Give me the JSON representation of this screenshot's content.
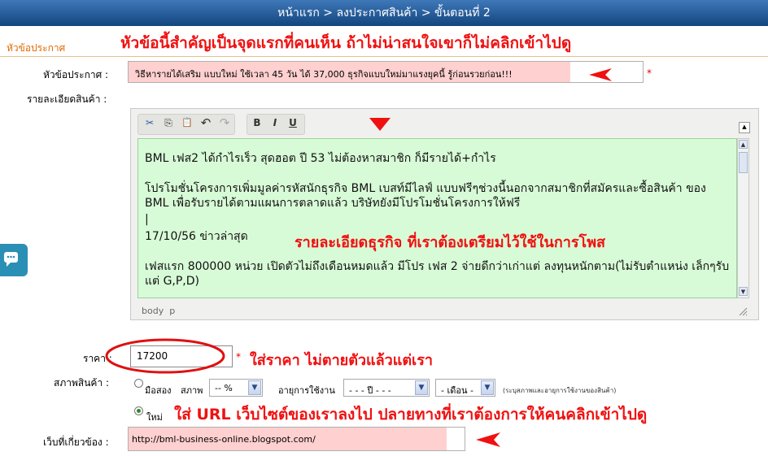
{
  "header": {
    "breadcrumb": "หน้าแรก > ลงประกาศสินค้า > ขั้นตอนที่ 2"
  },
  "section": {
    "title": "หัวข้อประกาศ"
  },
  "annotations": {
    "title_note": "หัวข้อนี้สำคัญเป็นจุดแรกที่คนเห็น ถ้าไม่น่าสนใจเขาก็ไม่คลิกเข้าไปดู",
    "detail_note": "รายละเอียดธุรกิจ ที่เราต้องเตรียมไว้ใช้ในการโพส",
    "price_note": "ใส่ราคา ไม่ตายตัวแล้วแต่เรา",
    "url_note": "ใส่ URL เว็บไซต์ของเราลงไป ปลายทางที่เราต้องการให้คนคลิกเข้าไปดู"
  },
  "form": {
    "title_label": "หัวข้อประกาศ :",
    "title_value": "วิธีหารายได้เสริม แบบใหม่ ใช้เวลา 45 วัน ได้ 37,000 ธุรกิจแบบใหม่มาแรงยุคนี้ รู้ก่อนรวยก่อน!!!",
    "required_mark": "*",
    "detail_label": "รายละเอียดสินค้า :",
    "price_label": "ราคา :",
    "price_value": "17200",
    "condition_label": "สภาพสินค้า :",
    "used_label": "มือสอง",
    "condition_state_label": "สภาพ",
    "condition_select": "-- %",
    "usage_label": "อายุการใช้งาน",
    "year_select": "- - - ปี - - -",
    "month_select": "- เดือน -",
    "usage_hint": "(ระบุสภาพและอายุการใช้งานของสินค้า)",
    "new_label": "ใหม่",
    "website_label": "เว็บที่เกี่ยวข้อง :",
    "website_value": "http://bml-business-online.blogspot.com/"
  },
  "editor": {
    "toolbar": {
      "cut": "✂",
      "copy": "⎘",
      "paste": "📋",
      "undo": "↶",
      "redo": "↷",
      "bold": "B",
      "italic": "I",
      "underline": "U"
    },
    "content": [
      "BML เฟส2 ได้กำไรเร็ว สุดฮอต ปี 53 ไม่ต้องหาสมาชิก ก็มีรายได้+กำไร",
      "โปรโมชั่นโครงการเพิ่มมูลค่ารหัสนักธุรกิจ BML เบสท์มีไลฟ์ แบบฟรีๆช่วงนี้นอกจากสมาชิกที่สมัครและซื้อสินค้า ของ BML เพื่อรับรายได้ตามแผนการตลาดแล้ว บริษัทยังมีโปรโมชั่นโครงการให้ฟรี",
      "|",
      "17/10/56 ข่าวล่าสุด",
      "เฟสแรก 800000 หน่วย เปิดตัวไม่ถึงเดือนหมดแล้ว มีโปร เฟส 2 จ่ายดีกว่าเก่าแต่ ลงทุนหนักตาม(ไม่รับตำแหน่ง เล็กๆรับแต่ G,P,D)"
    ],
    "status_path": "body  p"
  },
  "colors": {
    "accent": "#1a4f8b",
    "note_red": "#f01010",
    "highlight": "#ffd0d0",
    "editor_bg": "#d8fbd7"
  }
}
